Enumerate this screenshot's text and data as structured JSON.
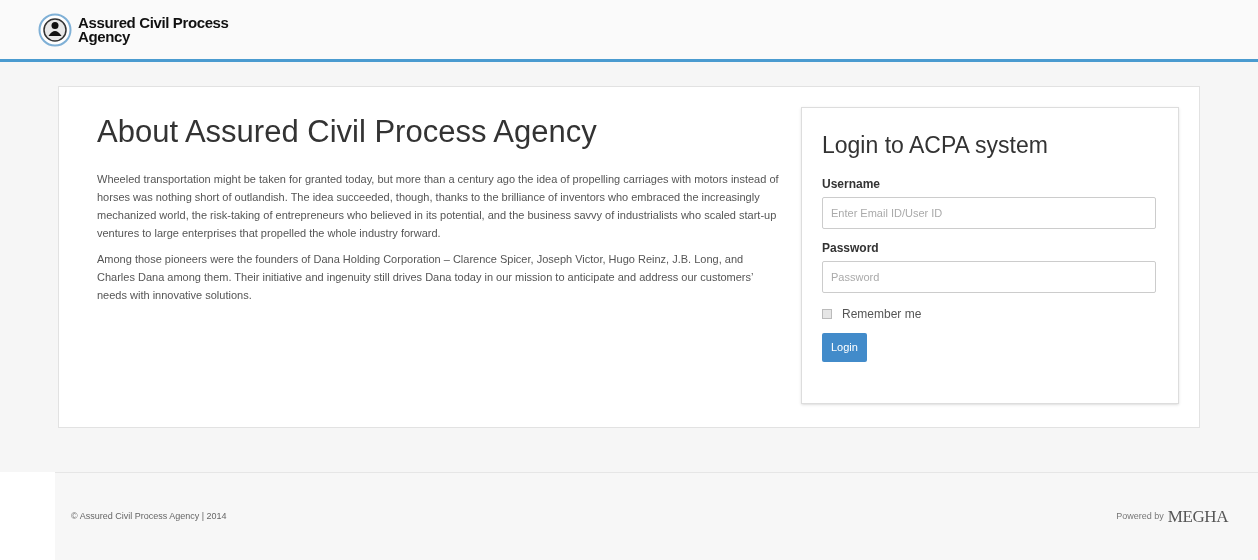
{
  "header": {
    "brand": "Assured Civil Process\nAgency"
  },
  "about": {
    "title": "About Assured Civil Process Agency",
    "paragraphs": [
      "Wheeled transportation might be taken for granted today, but more than a century ago the idea of propelling carriages with motors instead of horses was nothing short of outlandish. The idea succeeded, though, thanks to the brilliance of inventors who embraced the increasingly mechanized world, the risk-taking of entrepreneurs who believed in its potential, and the business savvy of industrialists who scaled start-up ventures to large enterprises that propelled the whole industry forward.",
      "Among those pioneers were the founders of Dana Holding Corporation – Clarence Spicer, Joseph Victor, Hugo Reinz, J.B. Long, and Charles Dana among them. Their initiative and ingenuity still drives Dana today in our mission to anticipate and address our customers’ needs with innovative solutions."
    ]
  },
  "login": {
    "title": "Login to ACPA system",
    "fields": [
      {
        "label": "Username",
        "placeholder": "Enter Email ID/User ID"
      },
      {
        "label": "Password",
        "placeholder": "Password"
      }
    ],
    "remember": {
      "label": "Remember me",
      "checked": false
    },
    "button": "Login"
  },
  "footer": {
    "copyright": "© Assured Civil Process Agency | 2014",
    "powered": "Powered by",
    "logo": "MEGHA"
  }
}
